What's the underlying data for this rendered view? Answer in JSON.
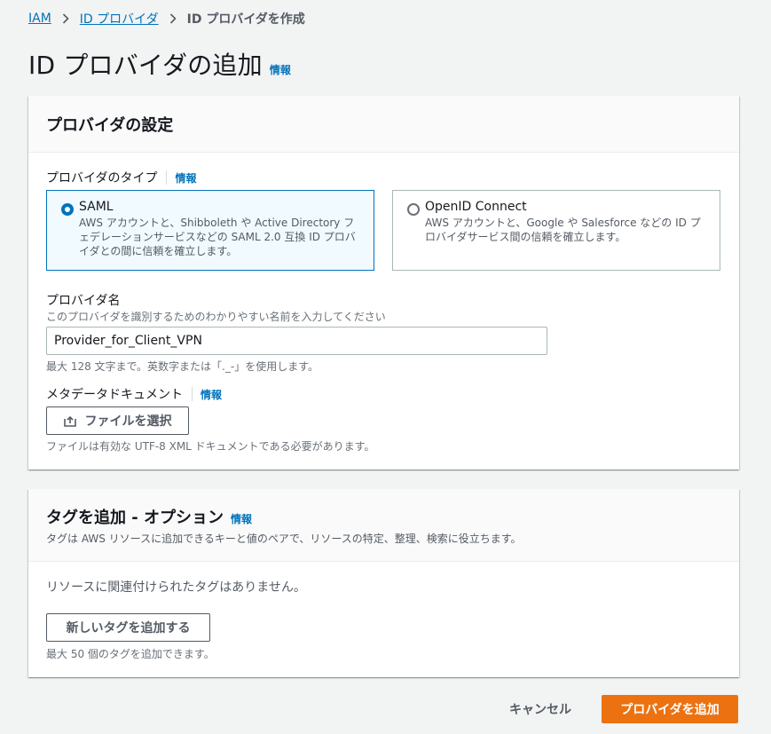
{
  "breadcrumb": {
    "items": [
      "IAM",
      "ID プロバイダ"
    ],
    "current": "ID プロバイダを作成"
  },
  "page": {
    "title": "ID プロバイダの追加",
    "info": "情報"
  },
  "settings": {
    "title": "プロバイダの設定",
    "provider_type_label": "プロバイダのタイプ",
    "provider_type_info": "情報",
    "types": [
      {
        "title": "SAML",
        "description": "AWS アカウントと、Shibboleth や Active Directory フェデレーションサービスなどの SAML 2.0 互換 ID プロバイダとの間に信頼を確立します。",
        "selected": true
      },
      {
        "title": "OpenID Connect",
        "description": "AWS アカウントと、Google や Salesforce などの ID プロバイダサービス間の信頼を確立します。",
        "selected": false
      }
    ],
    "provider_name_label": "プロバイダ名",
    "provider_name_description": "このプロバイダを識別するためのわかりやすい名前を入力してください",
    "provider_name_value": "Provider_for_Client_VPN",
    "provider_name_constraint": "最大 128 文字まで。英数字または「._-」を使用します。",
    "metadata_label": "メタデータドキュメント",
    "metadata_info": "情報",
    "file_button_label": "ファイルを選択",
    "file_description": "ファイルは有効な UTF-8 XML ドキュメントである必要があります。"
  },
  "tags": {
    "title": "タグを追加 - オプション",
    "info": "情報",
    "description": "タグは AWS リソースに追加できるキーと値のペアで、リソースの特定、整理、検索に役立ちます。",
    "empty_message": "リソースに関連付けられたタグはありません。",
    "add_button_label": "新しいタグを追加する",
    "limit_text": "最大 50 個のタグを追加できます。"
  },
  "footer": {
    "cancel_label": "キャンセル",
    "submit_label": "プロバイダを追加"
  },
  "colors": {
    "primary": "#ec7211",
    "link": "#0073bb",
    "selected_tile_bg": "#f1faff"
  }
}
